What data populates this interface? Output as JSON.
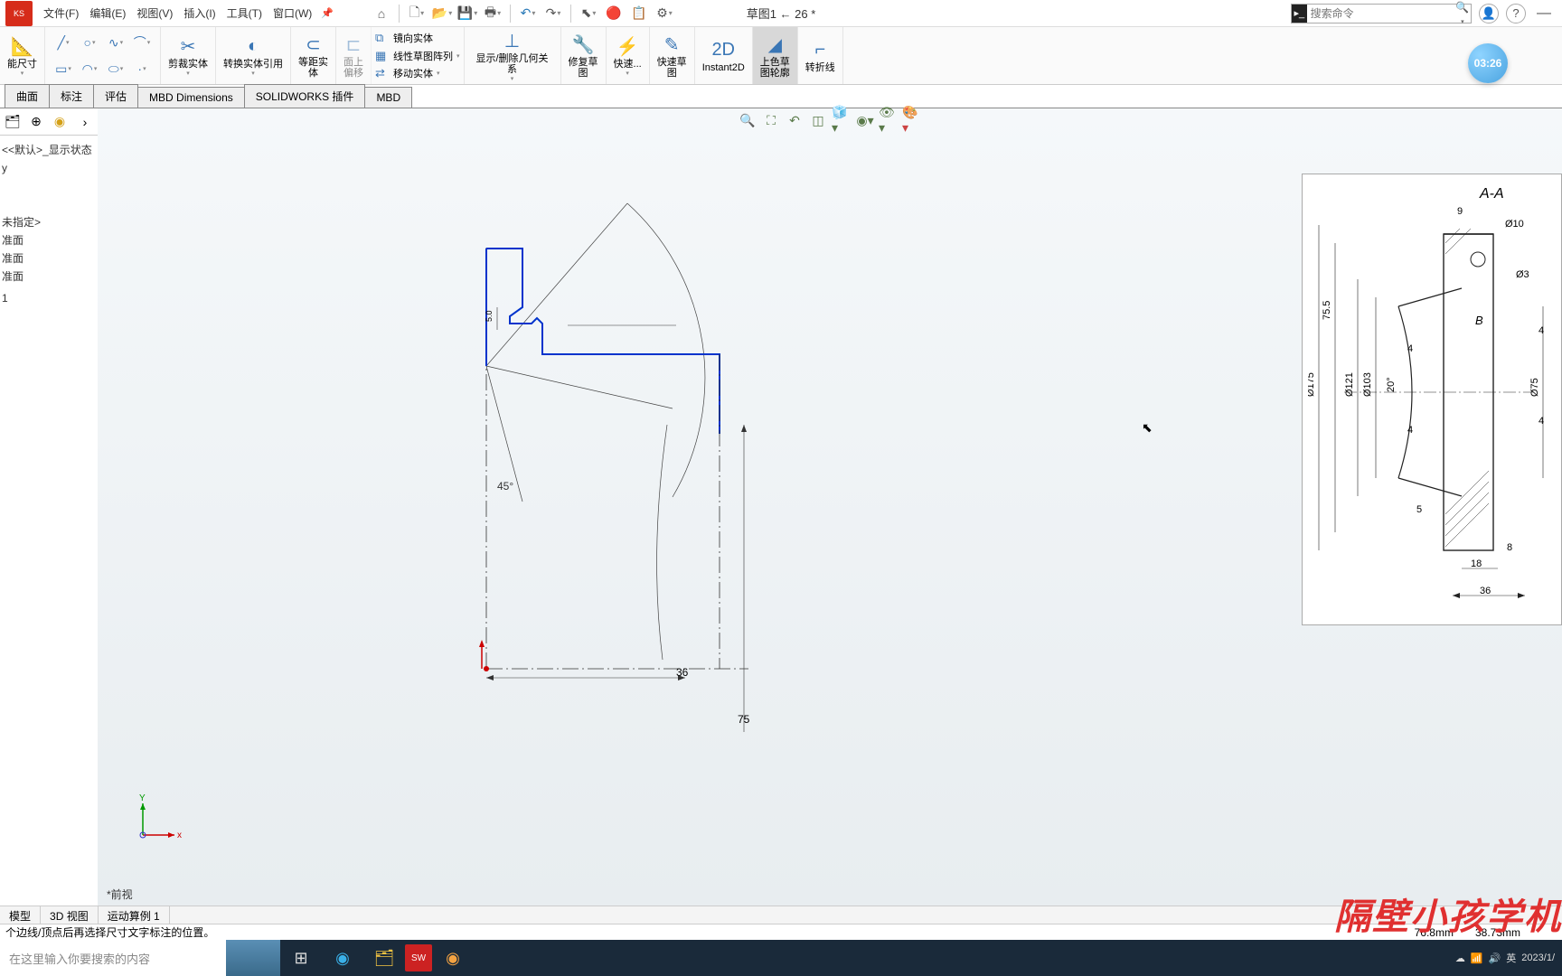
{
  "app": {
    "logo": "KS",
    "doc_title": "草图1 ← 26 *"
  },
  "menu": {
    "file": "文件(F)",
    "edit": "编辑(E)",
    "view": "视图(V)",
    "insert": "插入(I)",
    "tools": "工具(T)",
    "window": "窗口(W)"
  },
  "search": {
    "placeholder": "搜索命令"
  },
  "ribbon": {
    "smart_dim": "能尺寸",
    "trim": "剪裁实体",
    "convert": "转换实体引用",
    "offset": "等距实\n体",
    "surface_offset": "面上\n偏移",
    "mirror": "镜向实体",
    "linear_pattern": "线性草图阵列",
    "move": "移动实体",
    "show_del_rel": "显示/删除几何关系",
    "repair": "修复草\n图",
    "quick1": "快速...",
    "quick_sketch": "快速草\n图",
    "instant2d": "Instant2D",
    "shaded": "上色草\n图轮廓",
    "jog": "转折线"
  },
  "feature_tabs": {
    "curve": "曲面",
    "annotate": "标注",
    "eval": "评估",
    "mbd_dim": "MBD Dimensions",
    "sw_addin": "SOLIDWORKS 插件",
    "mbd": "MBD"
  },
  "timer": "03:26",
  "tree": {
    "state": "<<默认>_显示状态",
    "y": "y",
    "unspec": "未指定>",
    "plane1": "准面",
    "plane2": "准面",
    "plane3": "准面",
    "sketch_feat": "1"
  },
  "sketch": {
    "angle_45": "45°",
    "dim_w": "36",
    "dim_h": "75",
    "small_50": "5.0"
  },
  "ref": {
    "title": "A-A",
    "d9": "9",
    "d10": "Ø10",
    "d3": "Ø3",
    "d755": "75.5",
    "d175": "Ø175",
    "d121": "Ø121",
    "d103": "Ø103",
    "a20": "20°",
    "b": "B",
    "d75": "Ø75",
    "d4a": "4",
    "d4b": "4",
    "d4c": "4",
    "d4d": "4",
    "d5": "5",
    "d8": "8",
    "d18": "18",
    "d36": "36"
  },
  "view_label": "*前视",
  "triad": {
    "x": "x",
    "y": "Y"
  },
  "bottom_tabs": {
    "model": "模型",
    "view3d": "3D 视图",
    "motion": "运动算例 1"
  },
  "status": {
    "hint": "个边线/顶点后再选择尺寸文字标注的位置。",
    "dim1": "76.8mm",
    "dim2": "38.73mm"
  },
  "taskbar": {
    "search_placeholder": "在这里输入你要搜索的内容",
    "lang": "英",
    "date": "2023/1/"
  },
  "watermark": "隔壁小孩学机"
}
